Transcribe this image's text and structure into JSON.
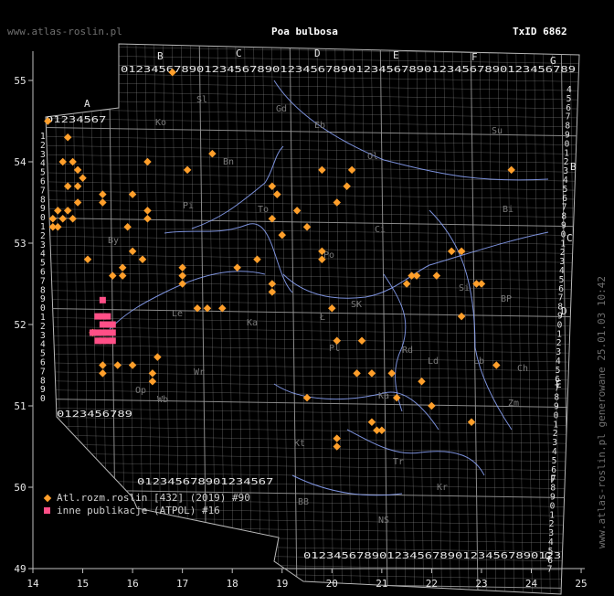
{
  "header": {
    "site": "www.atlas-roslin.pl",
    "species": "Poa bulbosa",
    "taxid": "TxID 6862"
  },
  "footer": {
    "generated": "www.atlas-roslin.pl generowane 25.01.03 10:42"
  },
  "legend": [
    {
      "symbol": "diamond",
      "color": "#ff9f2b",
      "label": "Atl.rozm.roslin [432] (2019) #90"
    },
    {
      "symbol": "square",
      "color": "#ff4f87",
      "label": "inne publikacje (ATPOL) #16"
    }
  ],
  "axes": {
    "x_ticks": [
      "14",
      "15",
      "16",
      "17",
      "18",
      "19",
      "20",
      "21",
      "22",
      "23",
      "24",
      "25"
    ],
    "y_ticks": [
      "55",
      "54",
      "53",
      "52",
      "51",
      "50",
      "49"
    ]
  },
  "grid": {
    "column_letters": [
      "A",
      "B",
      "C",
      "D",
      "E",
      "F",
      "G"
    ],
    "row_letters": [
      "B",
      "C",
      "D",
      "E",
      "F",
      "G"
    ],
    "digits": "0123456789"
  },
  "region_labels": [
    "Sl",
    "Gd",
    "Ko",
    "Eb",
    "Su",
    "Ol",
    "Bn",
    "By",
    "Bi",
    "Ci",
    "Po",
    "Pi",
    "To",
    "Si",
    "Ł",
    "SK",
    "Le",
    "Ka",
    "BP",
    "Ld",
    "Pl",
    "Rd",
    "Lb",
    "Ch",
    "Wb",
    "Wr",
    "Op",
    "Kt",
    "Ka",
    "Tr",
    "Zm",
    "BB",
    "NS",
    "Kr"
  ],
  "colors": {
    "background": "#000000",
    "grid": "#9a9a9a",
    "rivers": "#8fa8ff",
    "border": "#b9b9b9",
    "atlas_points": "#ff9f2b",
    "atpol_points": "#ff4f87"
  },
  "points_atlas": [
    [
      16.8,
      55.1
    ],
    [
      14.3,
      54.5
    ],
    [
      14.7,
      54.3
    ],
    [
      14.6,
      54.0
    ],
    [
      14.8,
      54.0
    ],
    [
      14.9,
      53.9
    ],
    [
      15.0,
      53.8
    ],
    [
      14.9,
      53.7
    ],
    [
      14.7,
      53.7
    ],
    [
      14.9,
      53.5
    ],
    [
      15.4,
      53.6
    ],
    [
      15.4,
      53.5
    ],
    [
      14.5,
      53.4
    ],
    [
      14.6,
      53.3
    ],
    [
      14.7,
      53.4
    ],
    [
      14.4,
      53.2
    ],
    [
      14.5,
      53.2
    ],
    [
      14.8,
      53.3
    ],
    [
      14.4,
      53.3
    ],
    [
      15.1,
      52.8
    ],
    [
      16.3,
      53.4
    ],
    [
      16.3,
      53.3
    ],
    [
      16.3,
      54.0
    ],
    [
      16.0,
      53.6
    ],
    [
      15.9,
      53.2
    ],
    [
      16.2,
      52.8
    ],
    [
      17.1,
      53.9
    ],
    [
      17.6,
      54.1
    ],
    [
      16.0,
      52.9
    ],
    [
      15.6,
      52.6
    ],
    [
      15.8,
      52.7
    ],
    [
      15.8,
      52.6
    ],
    [
      17.0,
      52.7
    ],
    [
      17.0,
      52.6
    ],
    [
      17.0,
      52.5
    ],
    [
      17.3,
      52.2
    ],
    [
      17.5,
      52.2
    ],
    [
      17.8,
      52.2
    ],
    [
      18.1,
      52.7
    ],
    [
      18.5,
      52.8
    ],
    [
      18.8,
      52.5
    ],
    [
      18.8,
      52.4
    ],
    [
      19.0,
      53.1
    ],
    [
      18.8,
      53.3
    ],
    [
      18.9,
      53.6
    ],
    [
      18.8,
      53.7
    ],
    [
      18.9,
      53.6
    ],
    [
      19.3,
      53.4
    ],
    [
      19.5,
      53.2
    ],
    [
      19.8,
      52.9
    ],
    [
      19.8,
      52.8
    ],
    [
      20.0,
      52.2
    ],
    [
      20.3,
      53.7
    ],
    [
      20.4,
      53.9
    ],
    [
      20.1,
      53.5
    ],
    [
      19.8,
      53.9
    ],
    [
      20.6,
      51.8
    ],
    [
      20.5,
      51.4
    ],
    [
      20.8,
      51.4
    ],
    [
      21.2,
      51.4
    ],
    [
      21.3,
      51.1
    ],
    [
      21.6,
      52.6
    ],
    [
      21.7,
      52.6
    ],
    [
      21.5,
      52.5
    ],
    [
      21.8,
      51.3
    ],
    [
      22.4,
      52.9
    ],
    [
      22.6,
      52.9
    ],
    [
      22.9,
      52.5
    ],
    [
      23.0,
      52.5
    ],
    [
      22.6,
      52.1
    ],
    [
      22.1,
      52.6
    ],
    [
      22.0,
      51.0
    ],
    [
      22.8,
      50.8
    ],
    [
      23.3,
      51.5
    ],
    [
      23.6,
      53.9
    ],
    [
      19.5,
      51.1
    ],
    [
      20.1,
      50.6
    ],
    [
      20.1,
      50.5
    ],
    [
      20.8,
      50.8
    ],
    [
      20.9,
      50.7
    ],
    [
      21.0,
      50.7
    ],
    [
      15.2,
      51.9
    ],
    [
      15.4,
      51.5
    ],
    [
      15.4,
      51.4
    ],
    [
      15.7,
      51.5
    ],
    [
      16.0,
      51.5
    ],
    [
      16.5,
      51.6
    ],
    [
      16.4,
      51.4
    ],
    [
      16.4,
      51.3
    ],
    [
      20.1,
      51.8
    ]
  ],
  "points_atpol": [
    [
      15.4,
      52.3
    ],
    [
      15.4,
      52.0
    ],
    [
      15.5,
      52.0
    ],
    [
      15.3,
      51.9
    ],
    [
      15.4,
      51.9
    ],
    [
      15.5,
      51.9
    ],
    [
      15.6,
      51.9
    ],
    [
      15.2,
      51.9
    ],
    [
      15.3,
      51.8
    ],
    [
      15.5,
      51.8
    ],
    [
      15.6,
      51.8
    ],
    [
      15.4,
      51.8
    ],
    [
      15.5,
      52.1
    ],
    [
      15.3,
      52.1
    ],
    [
      15.6,
      52.0
    ],
    [
      15.4,
      52.1
    ]
  ]
}
